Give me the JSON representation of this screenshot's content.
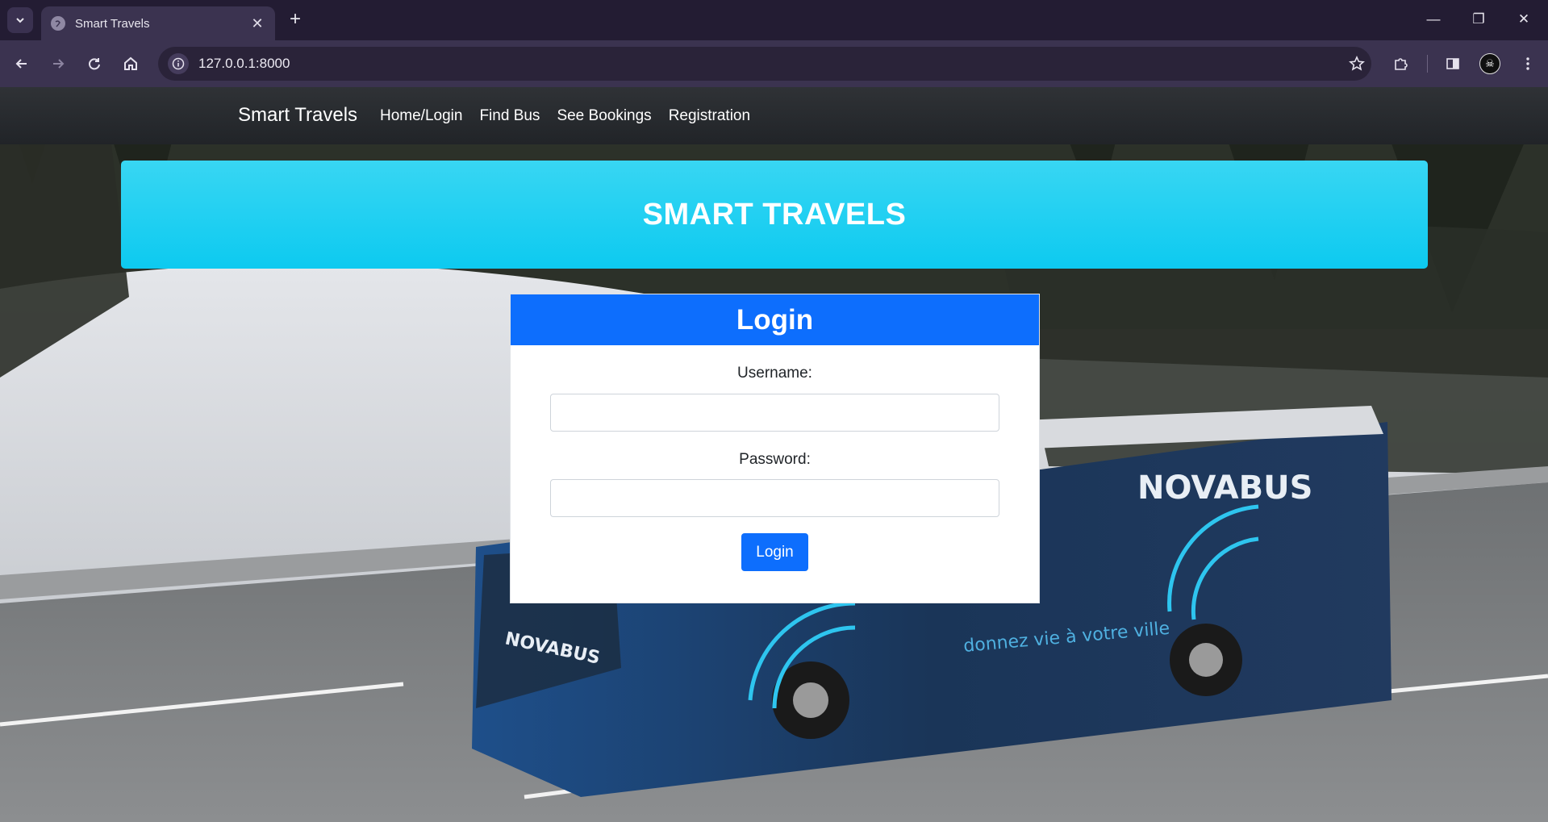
{
  "browser": {
    "tab_title": "Smart Travels",
    "url": "127.0.0.1:8000",
    "icons": {
      "tab_list": "chevron-down-icon",
      "favicon": "globe-icon",
      "close_tab": "close-icon",
      "new_tab": "plus-icon",
      "back": "arrow-left-icon",
      "forward": "arrow-right-icon",
      "reload": "reload-icon",
      "home": "home-icon",
      "site_info": "info-icon",
      "bookmark": "star-icon",
      "extensions": "puzzle-icon",
      "side_panel": "side-panel-icon",
      "menu": "kebab-menu-icon"
    }
  },
  "navbar": {
    "brand": "Smart Travels",
    "links": [
      "Home/Login",
      "Find Bus",
      "See Bookings",
      "Registration"
    ]
  },
  "hero": {
    "title": "SMART TRAVELS"
  },
  "login_card": {
    "header": "Login",
    "username_label": "Username:",
    "username_value": "",
    "password_label": "Password:",
    "password_value": "",
    "submit_label": "Login"
  },
  "background_image": {
    "bus_brand": "NOVABUS",
    "bus_slogan": "donnez vie à votre ville"
  },
  "colors": {
    "navbar": "#212529",
    "hero": "#0dcaf0",
    "primary": "#0d6efd",
    "browser_frame": "#231c33"
  }
}
